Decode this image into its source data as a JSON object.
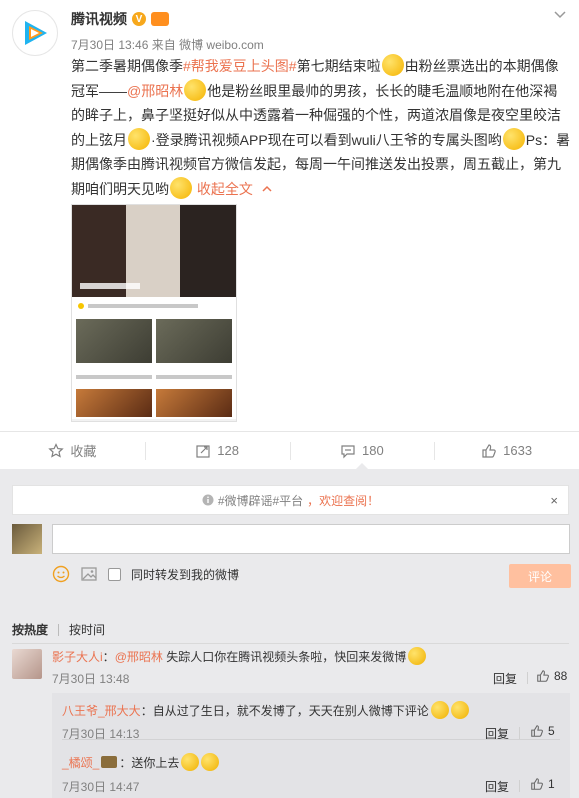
{
  "post": {
    "author": "腾讯视频",
    "vip_mark": "V",
    "time": "7月30日 13:46",
    "source_prefix": "来自",
    "source": "微博 weibo.com",
    "text_1": "第二季暑期偶像季",
    "topic_1": "#帮我爱豆上头图#",
    "text_2": "第七期结束啦",
    "text_3": "由粉丝票选出的本期偶像冠军——",
    "mention": "@邢昭林",
    "text_4": "他是粉丝眼里最帅的男孩，长长的睫毛温顺地附在他深褐的眸子上，鼻子坚挺好似从中透露着一种倔强的个性，两道浓眉像是夜空里皎洁的上弦月",
    "text_5": "·登录腾讯视频APP现在可以看到wuli八王爷的专属头图哟",
    "text_6": "Ps：暑期偶像季由腾讯视频官方微信发起，每周一午间推送发出投票，周五截止，第九期咱们明天见哟",
    "collapse_label": "收起全文",
    "collapse_icon": "chevron-up"
  },
  "actions": {
    "favorite": {
      "label": "收藏",
      "icon": "star"
    },
    "repost": {
      "count": "128",
      "icon": "repost"
    },
    "comment": {
      "count": "180",
      "icon": "comment"
    },
    "like": {
      "count": "1633",
      "icon": "thumbs-up"
    }
  },
  "comments_panel": {
    "notice_tag": "#微博辟谣#平台",
    "notice_hl": "，欢迎查阅！",
    "close_symbol": "×",
    "compose_placeholder": "",
    "also_repost": "同时转发到我的微博",
    "submit_label": "评论",
    "sort_hot": "按热度",
    "sort_time": "按时间"
  },
  "comments": [
    {
      "user": "影子大人i",
      "sep": "：",
      "mention": "@邢昭林",
      "text": "失踪人口你在腾讯视频头条啦，快回来发微博",
      "time": "7月30日 13:48",
      "reply_label": "回复",
      "likes": "88"
    }
  ],
  "replies": [
    {
      "user": "八王爷_邢大大",
      "sep": "：",
      "text": "自从过了生日，就不发博了，天天在别人微博下评论",
      "time": "7月30日 14:13",
      "reply_label": "回复",
      "likes": "5"
    },
    {
      "user": "_橘颂_",
      "sep": "：",
      "text": "送你上去",
      "time": "7月30日 14:47",
      "reply_label": "回复",
      "likes": "1"
    }
  ],
  "colors": {
    "link": "#eb7350",
    "panel_bg": "#eaeaec",
    "submit_bg": "#ffc09f"
  }
}
